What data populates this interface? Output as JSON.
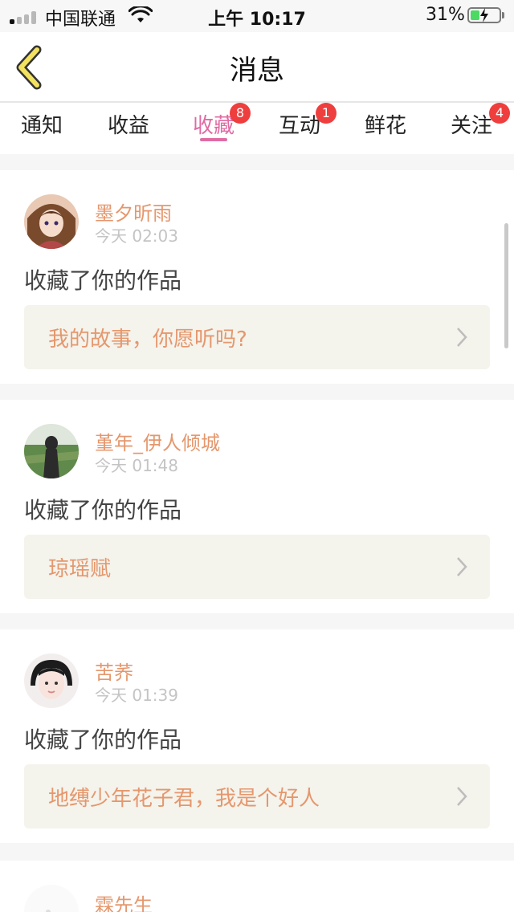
{
  "status_bar": {
    "carrier": "中国联通",
    "time": "上午 10:17",
    "battery_percent": "31%",
    "battery_level": 0.31,
    "wifi_icon": "wifi-icon",
    "signal_icon": "signal-icon",
    "charging_icon": "bolt-icon"
  },
  "nav": {
    "title": "消息",
    "back_icon": "chevron-left-icon"
  },
  "tabs": [
    {
      "label": "通知",
      "badge": ""
    },
    {
      "label": "收益",
      "badge": ""
    },
    {
      "label": "收藏",
      "badge": "8",
      "active": true
    },
    {
      "label": "互动",
      "badge": "1"
    },
    {
      "label": "鲜花",
      "badge": ""
    },
    {
      "label": "关注",
      "badge": "4"
    }
  ],
  "messages": [
    {
      "user": "墨夕昕雨",
      "time": "今天 02:03",
      "action": "收藏了你的作品",
      "work": "我的故事，你愿听吗?"
    },
    {
      "user": "堇年_伊人倾城",
      "time": "今天 01:48",
      "action": "收藏了你的作品",
      "work": "琼瑶赋"
    },
    {
      "user": "苦荞",
      "time": "今天 01:39",
      "action": "收藏了你的作品",
      "work": "地缚少年花子君，我是个好人"
    },
    {
      "user": "霖先生"
    }
  ],
  "colors": {
    "accent": "#e06ba3",
    "username": "#e5976d",
    "badge": "#ef3e3e",
    "back_arrow": "#f2e260"
  }
}
